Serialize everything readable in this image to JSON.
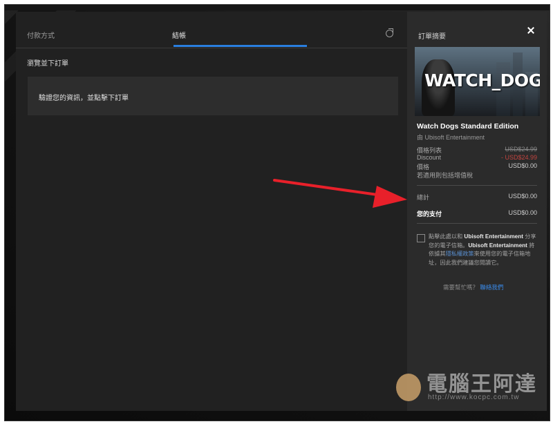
{
  "tabs": [
    {
      "label": "付款方式"
    },
    {
      "label": "結帳"
    }
  ],
  "section_heading": "瀏覽並下訂單",
  "card_text": "驗證您的資訊，並點擊下訂單",
  "summary": {
    "title": "訂單摘要",
    "hero_logo": "WATCH_DOGS",
    "product_title": "Watch Dogs Standard Edition",
    "publisher": "由 Ubisoft Entertainment",
    "rows": [
      {
        "label": "價格列表",
        "value": "USD$24.99"
      },
      {
        "label": "Discount",
        "value": "- USD$24.99"
      },
      {
        "label": "價格",
        "value": "USD$0.00"
      },
      {
        "label": "若適用則包括增值稅",
        "value": ""
      }
    ],
    "subtotal": {
      "label": "總計",
      "value": "USD$0.00"
    },
    "pay": {
      "label": "您的支付",
      "value": "USD$0.00"
    },
    "consent": {
      "p1": "點擊此處以和",
      "company1": "Ubisoft Entertainment",
      "p2": "分享您的電子信箱。",
      "company2": "Ubisoft Entertainment",
      "p3": "將依據其",
      "policy": "隱私權政策",
      "p4": "來使用您的電子信箱地址，因此我們建議您閱讀它。"
    },
    "help_text": "需要幫忙嗎？",
    "help_link": "聯絡我們"
  },
  "watermark": {
    "text": "電腦王阿達",
    "url": "http://www.kocpc.com.tw"
  },
  "colors": {
    "accent": "#2a7fe0",
    "discount": "#c0443f",
    "arrow": "#e8202a"
  }
}
